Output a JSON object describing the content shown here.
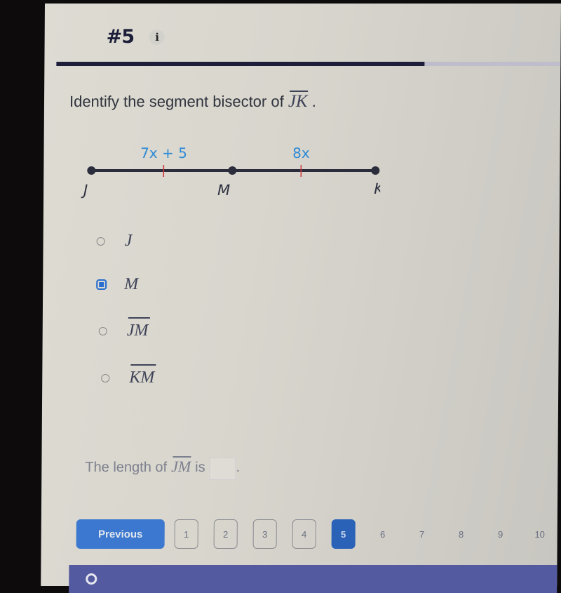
{
  "question": {
    "number": "#5",
    "info_icon": "info-icon",
    "progress_fraction": 0.73,
    "prompt_text": "Identify the segment bisector of",
    "prompt_segment": "JK",
    "prompt_end": "."
  },
  "diagram": {
    "left_label": "7x + 5",
    "right_label": "8x",
    "points": [
      "J",
      "M",
      "K"
    ],
    "label_color": "#2e8ad6",
    "tick_color": "#d0353a",
    "line_color": "#2b2d3d"
  },
  "options": [
    {
      "label": "J",
      "overline": false,
      "selected": false
    },
    {
      "label": "M",
      "overline": false,
      "selected": true
    },
    {
      "label": "JM",
      "overline": true,
      "selected": false
    },
    {
      "label": "KM",
      "overline": true,
      "selected": false
    }
  ],
  "length_question": {
    "prefix": "The length of",
    "segment": "JM",
    "middle": "is",
    "answer_value": "",
    "suffix": "."
  },
  "navigation": {
    "previous_label": "Previous",
    "pages": [
      "1",
      "2",
      "3",
      "4",
      "5",
      "6",
      "7",
      "8",
      "9",
      "10"
    ],
    "current_page": "5",
    "visited_pages": [
      "1",
      "2",
      "3",
      "4"
    ]
  },
  "colors": {
    "accent": "#3c78cf",
    "current_page": "#2a62b8",
    "progress": "#1e1d3a",
    "footer": "#545aa0"
  }
}
